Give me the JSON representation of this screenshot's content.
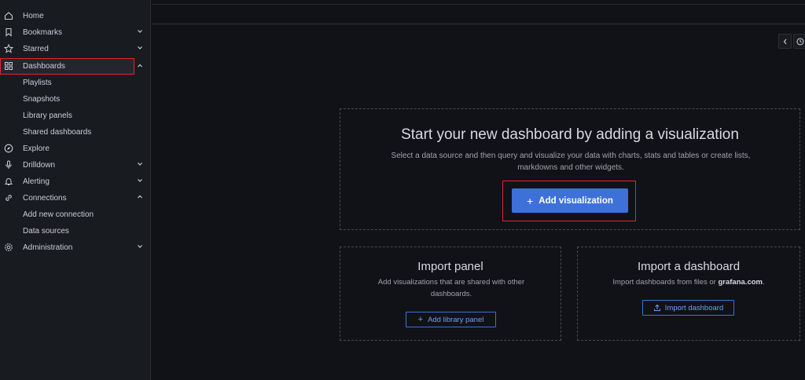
{
  "sidebar": {
    "items": [
      {
        "label": "Home",
        "icon": "home-icon"
      },
      {
        "label": "Bookmarks",
        "icon": "bookmark-icon",
        "chevron": "down"
      },
      {
        "label": "Starred",
        "icon": "star-icon",
        "chevron": "down"
      },
      {
        "label": "Dashboards",
        "icon": "apps-icon",
        "chevron": "up",
        "active": true
      },
      {
        "label": "Playlists",
        "sub": true
      },
      {
        "label": "Snapshots",
        "sub": true
      },
      {
        "label": "Library panels",
        "sub": true
      },
      {
        "label": "Shared dashboards",
        "sub": true
      },
      {
        "label": "Explore",
        "icon": "compass-icon"
      },
      {
        "label": "Drilldown",
        "icon": "microphone-icon",
        "chevron": "down"
      },
      {
        "label": "Alerting",
        "icon": "bell-icon",
        "chevron": "down"
      },
      {
        "label": "Connections",
        "icon": "link-icon",
        "chevron": "up"
      },
      {
        "label": "Add new connection",
        "sub": true
      },
      {
        "label": "Data sources",
        "sub": true
      },
      {
        "label": "Administration",
        "icon": "cog-icon",
        "chevron": "down"
      }
    ]
  },
  "main": {
    "title": "Start your new dashboard by adding a visualization",
    "description": "Select a data source and then query and visualize your data with charts, stats and tables or create lists, markdowns and other widgets.",
    "add_button_label": "Add visualization"
  },
  "import_panel": {
    "title": "Import panel",
    "description": "Add visualizations that are shared with other dashboards.",
    "button_label": "Add library panel"
  },
  "import_dashboard": {
    "title": "Import a dashboard",
    "description_prefix": "Import dashboards from files or ",
    "description_link": "grafana.com",
    "description_suffix": ".",
    "button_label": "Import dashboard"
  },
  "colors": {
    "accent": "#3d71d9",
    "highlight_outline": "#e0252e",
    "background": "#111217",
    "sidebar": "#181b1f"
  }
}
